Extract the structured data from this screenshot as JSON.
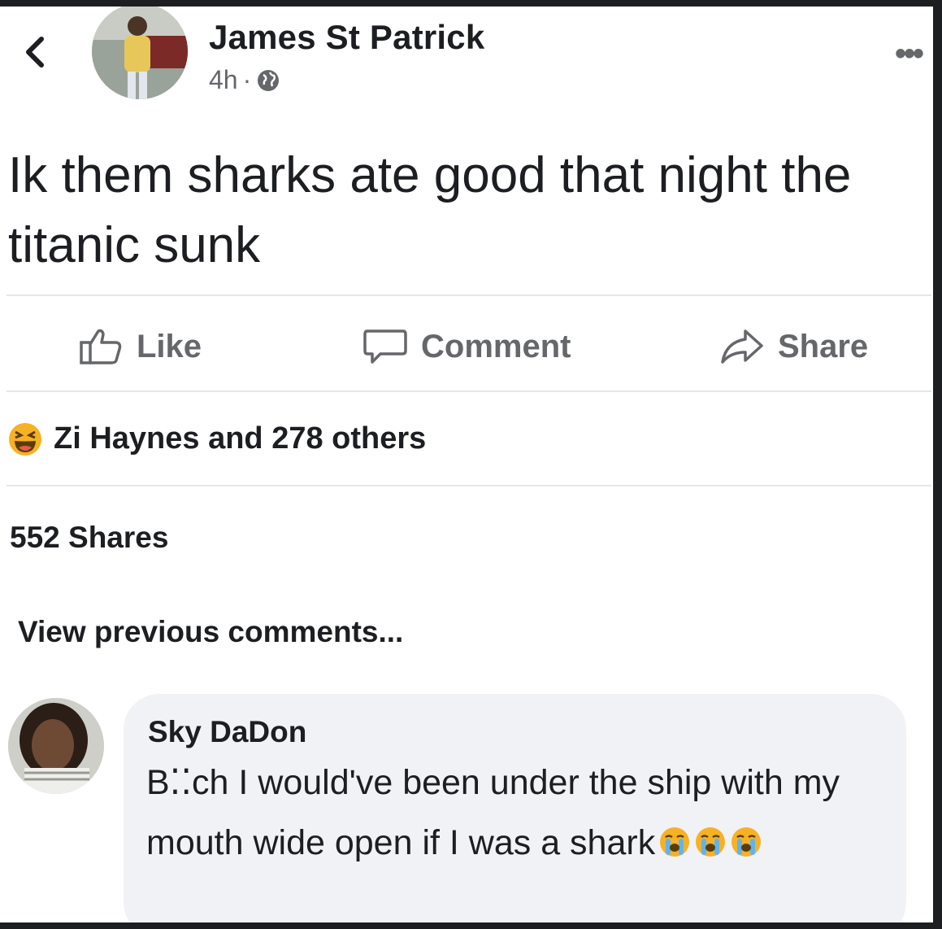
{
  "post": {
    "author": "James St Patrick",
    "time": "4h",
    "separator": "·",
    "text": "Ik them sharks ate good that night the titanic sunk"
  },
  "actions": {
    "like": "Like",
    "comment": "Comment",
    "share": "Share"
  },
  "reactions": {
    "summary": "Zi Haynes and 278 others"
  },
  "stats": {
    "shares": "552 Shares"
  },
  "comments": {
    "view_previous": "View previous comments...",
    "items": [
      {
        "name": "Sky DaDon",
        "text": "B⁚⁚ch I would've been under the ship with my mouth wide open if I was a shark"
      }
    ]
  },
  "colors": {
    "text": "#1c1e21",
    "secondary": "#65676b",
    "divider": "#e4e6eb",
    "bubble": "#f0f2f5",
    "emoji": "#f7b125"
  }
}
